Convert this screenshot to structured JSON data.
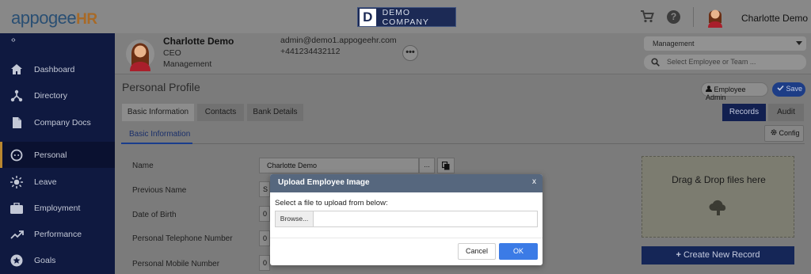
{
  "header": {
    "logo_main": "appogee",
    "logo_suffix": "HR",
    "company_mark": "D",
    "company_name": "DEMO COMPANY",
    "user_name": "Charlotte Demo",
    "help_glyph": "?"
  },
  "sidebar": {
    "toggle_glyph": "‹›",
    "items": [
      {
        "label": "Dashboard",
        "icon": "home-icon"
      },
      {
        "label": "Directory",
        "icon": "org-chart-icon"
      },
      {
        "label": "Company Docs",
        "icon": "document-icon"
      },
      {
        "label": "Personal",
        "icon": "face-icon",
        "active": true
      },
      {
        "label": "Leave",
        "icon": "sun-icon"
      },
      {
        "label": "Employment",
        "icon": "briefcase-icon"
      },
      {
        "label": "Performance",
        "icon": "trending-up-icon"
      },
      {
        "label": "Goals",
        "icon": "star-icon"
      }
    ]
  },
  "employee": {
    "name": "Charlotte Demo",
    "role": "CEO",
    "department": "Management",
    "email": "admin@demo1.appogeehr.com",
    "phone": "+441234432112",
    "more_glyph": "•••"
  },
  "filters": {
    "team_select": "Management",
    "search_placeholder": "Select Employee or Team ..."
  },
  "page": {
    "title": "Personal Profile",
    "employee_admin_label": "Employee Admin",
    "save_label": "Save",
    "tabs": [
      "Basic Information",
      "Contacts",
      "Bank Details"
    ],
    "records_label": "Records",
    "audit_label": "Audit",
    "subtab_label": "Basic Information",
    "config_label": "Config"
  },
  "form": {
    "fields": [
      {
        "label": "Name",
        "value": "Charlotte Demo"
      },
      {
        "label": "Previous Name",
        "value": "S"
      },
      {
        "label": "Date of Birth",
        "value": "0"
      },
      {
        "label": "Personal Telephone Number",
        "value": "0"
      },
      {
        "label": "Personal Mobile Number",
        "value": "0"
      }
    ],
    "ellipsis": "..."
  },
  "records_panel": {
    "dropzone_text": "Drag & Drop files here",
    "create_label": "Create New Record"
  },
  "modal": {
    "title": "Upload Employee Image",
    "close": "x",
    "prompt": "Select a file to upload from below:",
    "browse_label": "Browse...",
    "cancel_label": "Cancel",
    "ok_label": "OK"
  },
  "colors": {
    "sidebar_bg": "#0f1940",
    "accent_blue": "#3b7be6",
    "modal_header": "#56677e",
    "brand_orange": "#a86a27"
  }
}
